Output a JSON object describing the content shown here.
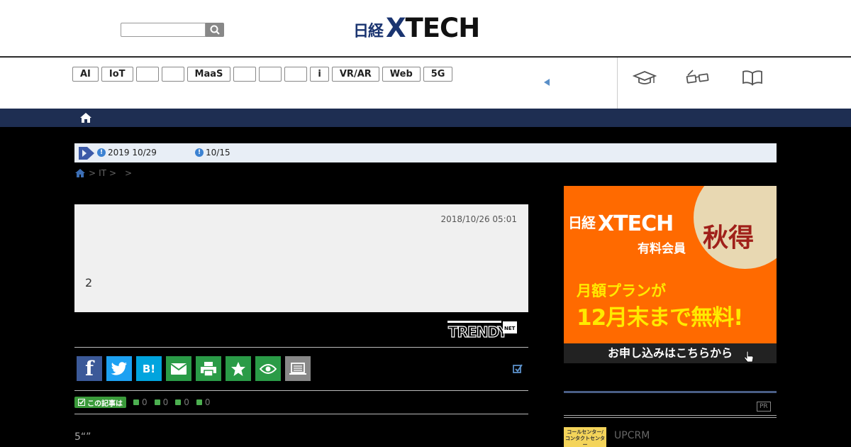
{
  "header": {
    "logo_jp": "日経",
    "logo_x": "X",
    "logo_rest": "TECH",
    "search_placeholder": ""
  },
  "tags": [
    "AI",
    "IoT",
    "",
    "",
    "MaaS",
    "",
    "",
    "",
    "i",
    "VR/AR",
    "Web",
    "5G"
  ],
  "notice": {
    "item1": "2019 10/29",
    "item2": "10/15"
  },
  "breadcrumb": {
    "sep1": ">",
    "section": "IT",
    "sep2": ">",
    "sep3": ">"
  },
  "article": {
    "date": "2018/10/26 05:01",
    "text": "2",
    "source_logo": "TRENDY NET"
  },
  "evaluation": {
    "badge_label": "この記事は",
    "counts": [
      "0",
      "0",
      "0",
      "0"
    ]
  },
  "body_text": "5“”",
  "ad": {
    "brand_jp": "日経",
    "brand_x": "X",
    "brand_rest": "TECH",
    "member": "有料会員",
    "aki": "秋得",
    "plan": "月額プランが",
    "free": "12月末まで無料!",
    "cta": "お申し込みはこちらから"
  },
  "sidebar": {
    "pr_badge": "PR",
    "pr_thumb_line1": "コールセンター/",
    "pr_thumb_line2": "コンタクトセンター",
    "pr_title": "UPCRM"
  },
  "colors": {
    "brand_navy": "#1a3470",
    "nav_bar": "#1e2e52",
    "ad_orange": "#ff6a00",
    "ad_yellow": "#ffea00",
    "share_green": "#2a9b47"
  }
}
